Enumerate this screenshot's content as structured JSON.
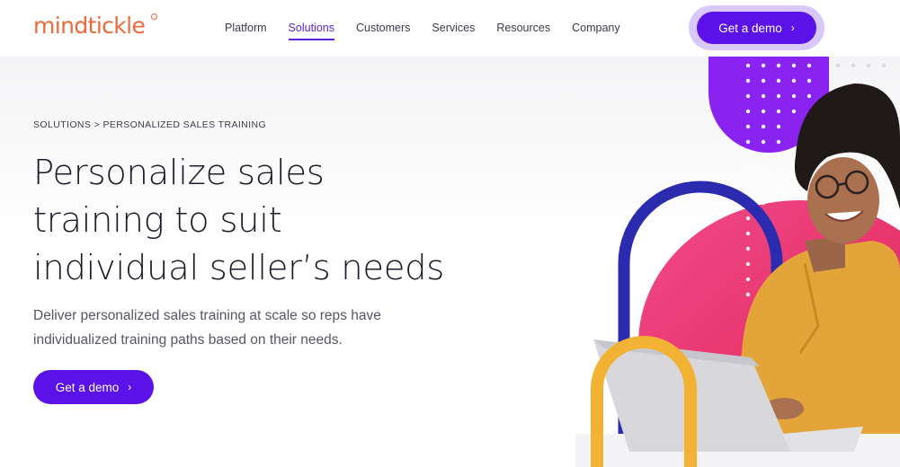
{
  "header": {
    "logo_text": "mindtickle",
    "nav": [
      {
        "label": "Platform",
        "active": false
      },
      {
        "label": "Solutions",
        "active": true
      },
      {
        "label": "Customers",
        "active": false
      },
      {
        "label": "Services",
        "active": false
      },
      {
        "label": "Resources",
        "active": false
      },
      {
        "label": "Company",
        "active": false
      }
    ],
    "cta_label": "Get a demo"
  },
  "hero": {
    "breadcrumb": "SOLUTIONS > PERSONALIZED SALES TRAINING",
    "headline_lines": [
      "Personalize sales",
      "training to suit",
      "individual seller’s needs"
    ],
    "subtext": "Deliver personalized sales training at scale so reps have individualized training paths based on their needs.",
    "cta_label": "Get a demo",
    "chevron": "›"
  },
  "colors": {
    "brand_orange": "#ee6a3a",
    "brand_purple": "#5a12e8",
    "ring": "#d8c8fb",
    "magenta": "#e8285f",
    "violet": "#8a22f0",
    "navy_arch": "#2b2bb0",
    "yellow_arch": "#f2b233",
    "shirt": "#e3a53a"
  }
}
